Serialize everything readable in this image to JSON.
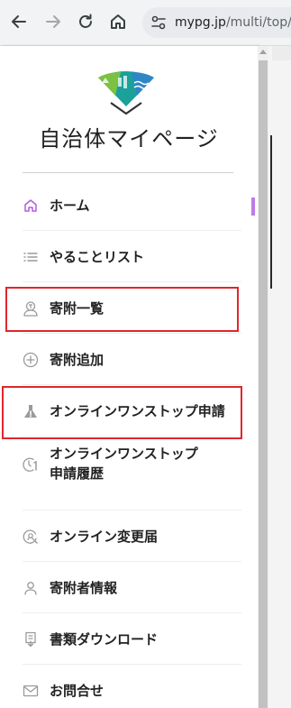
{
  "browser": {
    "url_host": "mypg.jp",
    "url_path": "/multi/top/",
    "icons": [
      "back-arrow-icon",
      "forward-arrow-icon",
      "reload-icon",
      "home-icon",
      "site-settings-icon"
    ]
  },
  "drawer": {
    "title": "自治体マイページ",
    "menu": [
      {
        "label": "ホーム",
        "icon": "home-icon",
        "active": true
      },
      {
        "label": "やることリスト",
        "icon": "list-icon"
      },
      {
        "label": "寄附一覧",
        "icon": "donation-list-icon",
        "highlighted": true
      },
      {
        "label": "寄附追加",
        "icon": "plus-circle-icon"
      },
      {
        "label": "オンラインワンストップ申請",
        "icon": "onestop-icon",
        "highlighted": true
      },
      {
        "label": "オンラインワンストップ申請履歴",
        "label_line1": "オンラインワンストップ",
        "label_line2": "申請履歴",
        "icon": "history-icon"
      },
      {
        "label": "オンライン変更届",
        "icon": "change-request-icon"
      },
      {
        "label": "寄附者情報",
        "icon": "person-icon"
      },
      {
        "label": "書類ダウンロード",
        "icon": "document-download-icon"
      },
      {
        "label": "お問合せ",
        "icon": "mail-icon"
      }
    ]
  },
  "colors": {
    "active_icon": "#b15be0",
    "highlight_border": "#e0262c",
    "icon_gray": "#9a9a9a",
    "logo_green": "#7cc142",
    "logo_teal": "#1ba09a",
    "logo_blue": "#2f86c7"
  }
}
